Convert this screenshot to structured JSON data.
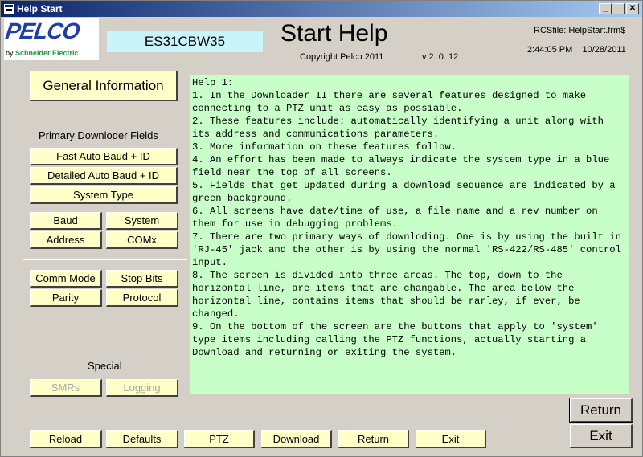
{
  "window": {
    "title": "Help Start",
    "min": "_",
    "max": "□",
    "close": "✕"
  },
  "logo": {
    "brand": "PELCO",
    "by": "by",
    "company": "Schneider Electric"
  },
  "header": {
    "system_type": "ES31CBW35",
    "title": "Start Help",
    "copyright": "Copyright Pelco 2011",
    "version": "v 2. 0. 12",
    "rcsfile": "RCSfile: HelpStart.frm$",
    "time": "2:44:05 PM",
    "date": "10/28/2011"
  },
  "left": {
    "general_info": "General Information",
    "primary_label": "Primary Downloder Fields",
    "fast_auto_baud": "Fast Auto  Baud + ID",
    "detailed_auto_baud": "Detailed Auto Baud + ID",
    "system_type": "System Type",
    "baud": "Baud",
    "system": "System",
    "address": "Address",
    "comx": "COMx",
    "comm_mode": "Comm Mode",
    "stop_bits": "Stop Bits",
    "parity": "Parity",
    "protocol": "Protocol",
    "special_label": "Special",
    "smrs": "SMRs",
    "logging": "Logging"
  },
  "help_text": "Help 1:\n1. In the Downloader II there are several features designed to make connecting to a PTZ unit as easy as possiable.\n2. These features include: automatically identifying a unit along with its address and communications parameters.\n3. More information on these features follow.\n4. An effort has been made to always indicate the system type in a blue field near the top of all screens.\n5. Fields that get updated during a download sequence are indicated by a green background.\n6. All screens have date/time of use, a file name and a rev number on them for use in debugging problems.\n7. There are two primary ways of downloding. One is by using the built in 'RJ-45' jack and the other is by using the normal 'RS-422/RS-485' control input.\n8. The screen is divided into three areas. The top, down to the horizontal line, are items that are changable. The area below the horizontal line, contains items that should be rarley, if ever, be changed.\n9. On the bottom of the screen are the buttons that apply to 'system' type items including calling the PTZ functions, actually starting a Download and returning or exiting the system.",
  "right": {
    "return": "Return",
    "exit": "Exit"
  },
  "bottom": {
    "reload": "Reload",
    "defaults": "Defaults",
    "ptz": "PTZ",
    "download": "Download",
    "return": "Return",
    "exit": "Exit"
  }
}
